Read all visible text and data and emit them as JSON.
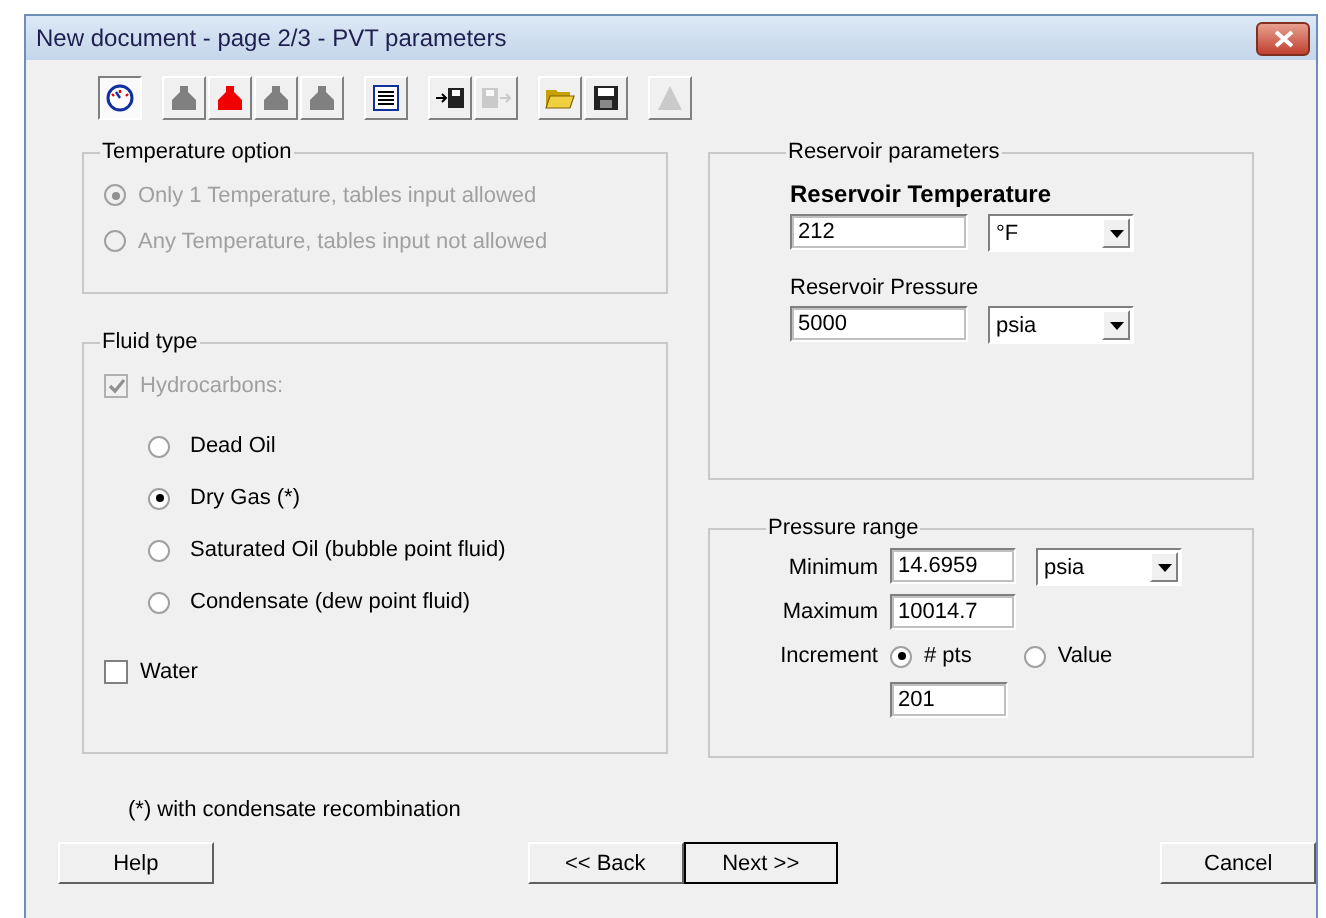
{
  "window": {
    "title": "New document - page 2/3 - PVT parameters"
  },
  "toolbar": [
    {
      "buttons": [
        {
          "kind": "gauge",
          "selected": true,
          "disabled": false
        }
      ]
    },
    {
      "buttons": [
        {
          "kind": "flask",
          "selected": false,
          "disabled": false
        },
        {
          "kind": "flask",
          "selected": true,
          "disabled": false
        },
        {
          "kind": "flask",
          "selected": false,
          "disabled": false
        },
        {
          "kind": "flask",
          "selected": false,
          "disabled": false
        }
      ]
    },
    {
      "buttons": [
        {
          "kind": "list",
          "selected": false,
          "disabled": false
        }
      ]
    },
    {
      "buttons": [
        {
          "kind": "import",
          "selected": false,
          "disabled": false
        },
        {
          "kind": "export",
          "selected": false,
          "disabled": true
        }
      ]
    },
    {
      "buttons": [
        {
          "kind": "open",
          "selected": false,
          "disabled": false
        },
        {
          "kind": "save",
          "selected": false,
          "disabled": false
        }
      ]
    },
    {
      "buttons": [
        {
          "kind": "triangle",
          "selected": false,
          "disabled": true
        }
      ]
    }
  ],
  "temperature_option": {
    "legend": "Temperature option",
    "options": [
      {
        "label": "Only 1 Temperature, tables input allowed",
        "selected": true,
        "disabled": true
      },
      {
        "label": "Any Temperature, tables input not allowed",
        "selected": false,
        "disabled": true
      }
    ]
  },
  "fluid_type": {
    "legend": "Fluid type",
    "hydrocarbons": {
      "label": "Hydrocarbons:",
      "checked": true,
      "disabled": true
    },
    "fluids": [
      {
        "label": "Dead Oil",
        "selected": false
      },
      {
        "label": "Dry Gas (*)",
        "selected": true
      },
      {
        "label": "Saturated Oil (bubble point fluid)",
        "selected": false
      },
      {
        "label": "Condensate (dew point fluid)",
        "selected": false
      }
    ],
    "water": {
      "label": "Water",
      "checked": false
    }
  },
  "reservoir_parameters": {
    "legend": "Reservoir parameters",
    "fields": [
      {
        "label": "Reservoir Temperature",
        "value": "212",
        "unit": "°F"
      },
      {
        "label": "Reservoir Pressure",
        "value": "5000",
        "unit": "psia"
      }
    ]
  },
  "pressure_range": {
    "legend": "Pressure range",
    "minimum": {
      "label": "Minimum",
      "value": "14.6959",
      "unit": "psia"
    },
    "maximum": {
      "label": "Maximum",
      "value": "10014.7"
    },
    "increment": {
      "label": "Increment",
      "options": [
        {
          "label": "# pts",
          "selected": true
        },
        {
          "label": "Value",
          "selected": false
        }
      ],
      "value": "201"
    }
  },
  "footnote": "(*) with condensate recombination",
  "buttons": [
    {
      "label": "Help"
    },
    {
      "label": "<< Back"
    },
    {
      "label": "Next >>"
    },
    {
      "label": "Cancel"
    }
  ]
}
